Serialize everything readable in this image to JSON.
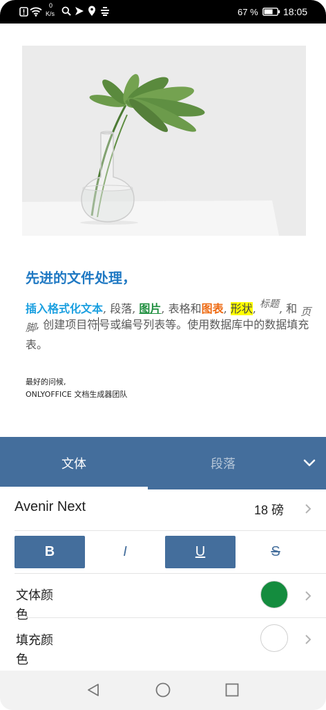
{
  "status_bar": {
    "left_icons": [
      "alert-icon",
      "wifi-icon",
      "search-icon",
      "navigation-icon",
      "location-icon",
      "feed-icon"
    ],
    "net_speed": {
      "value": "0",
      "unit": "K/s"
    },
    "battery_text": "67 %",
    "battery_level": 0.67,
    "time": "18:05"
  },
  "document": {
    "heading": "先进的文件处理，",
    "paragraph": {
      "formatted_text": "插入格式化文本",
      "sep_1": ", 段落, ",
      "image_text": "图片",
      "sep_2": ", 表格和",
      "chart_text": "图表",
      "sep_3": ", ",
      "shape_text": "形状",
      "sep_4": ", ",
      "header_text": "标题",
      "sep_5": ", 和 ",
      "footer_text_1": "页",
      "footer_text_2": "脚",
      "before_cursor": ", 创建项目符",
      "after_cursor": "号或编号列表等。使用数据库中的数据填充",
      "last_line": "表。"
    },
    "closing": "最好的问候,",
    "signature": "ONLYOFFICE 文档生成器团队"
  },
  "panel": {
    "tabs": [
      {
        "label": "文体",
        "active": true
      },
      {
        "label": "段落",
        "active": false
      }
    ],
    "font": {
      "name": "Avenir Next",
      "size": "18 磅"
    },
    "format_buttons": [
      {
        "label": "B",
        "active": true
      },
      {
        "label": "I",
        "active": false
      },
      {
        "label": "U",
        "active": true
      },
      {
        "label": "S",
        "active": false
      }
    ],
    "text_color": {
      "label": "文体颜色",
      "value": "#148c3e"
    },
    "fill_color": {
      "label": "填充颜色",
      "value": "#ffffff"
    }
  },
  "nav_bar": {
    "icons": [
      "back-icon",
      "home-icon",
      "recents-icon"
    ]
  },
  "theme": {
    "accent": "#446e9c"
  }
}
